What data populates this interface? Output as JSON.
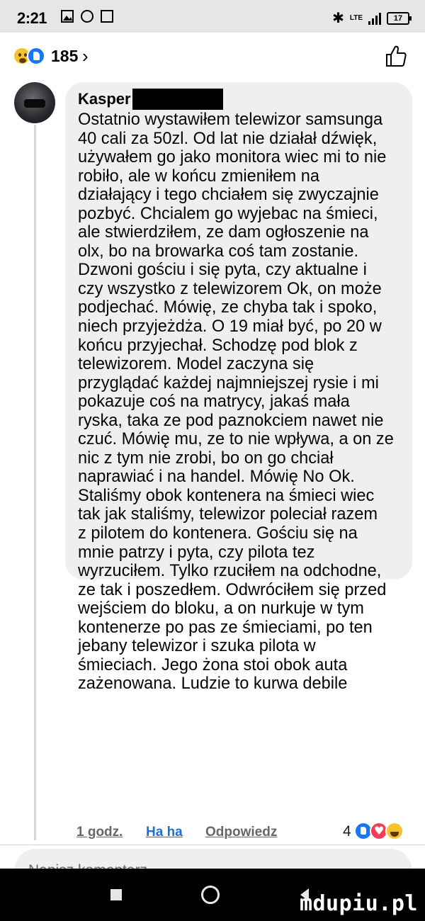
{
  "status_bar": {
    "time": "2:21",
    "network_label": "LTE",
    "battery": "17"
  },
  "header": {
    "reaction_count": "185",
    "chevron": "›"
  },
  "comment": {
    "author": "Kasper",
    "lines": [
      "Ostatnio wystawiłem telewizor samsunga",
      "40 cali za 50zl. Od lat nie działał dźwięk,",
      "używałem go jako monitora wiec mi to nie",
      "robiło, ale w końcu zmieniłem na",
      "działający i tego chciałem się zwyczajnie",
      "pozbyć. Chcialem go wyjebac na śmieci,",
      "ale stwierdziłem, ze dam ogłoszenie na",
      "olx, bo na browarka coś tam zostanie.",
      "Dzwoni gościu i się pyta, czy aktualne i",
      "czy wszystko z telewizorem Ok, on może",
      "podjechać. Mówię, ze chyba tak i spoko,",
      "niech przyjeżdża. O 19 miał być, po 20 w",
      "końcu przyjechał. Schodzę pod blok z",
      "telewizorem. Model zaczyna się",
      "przyglądać każdej najmniejszej rysie i mi",
      "pokazuje coś na matrycy, jakaś mała",
      "ryska, taka ze pod paznokciem nawet nie",
      "czuć. Mówię mu, ze to nie wpływa, a on ze",
      "nic z tym nie zrobi, bo on go chciał",
      "naprawiać i na handel. Mówię No Ok.",
      "Staliśmy obok kontenera na śmieci wiec",
      "tak jak staliśmy, telewizor poleciał razem",
      "z pilotem do kontenera. Gościu się na",
      "mnie patrzy i pyta, czy pilota tez",
      "wyrzuciłem. Tylko rzuciłem na odchodne,",
      "ze tak i poszedłem. Odwróciłem się przed",
      "wejściem do bloku, a on nurkuje w tym",
      "kontenerze po pas ze śmieciami, po ten",
      "jebany telewizor i szuka pilota w",
      "śmieciach. Jego żona stoi obok auta",
      "zażenowana. Ludzie to kurwa debile"
    ],
    "time_ago": "1 godz.",
    "reaction_label": "Ha ha",
    "reply_label": "Odpowiedz",
    "reaction_count": "4"
  },
  "composer": {
    "placeholder": "Napisz komentarz..."
  },
  "watermark": "mdupiu.pl",
  "colors": {
    "facebook_blue": "#1877f2",
    "bubble_bg": "#efeff2",
    "haha_active": "#1e6fd8",
    "love_red": "#f33e58",
    "haha_yellow": "#f7c22f"
  }
}
